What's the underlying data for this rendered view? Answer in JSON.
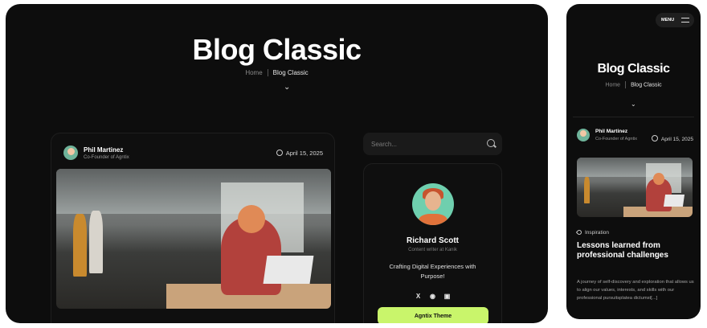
{
  "desktop": {
    "hero": {
      "title": "Blog Classic",
      "breadcrumb_home": "Home",
      "breadcrumb_current": "Blog Classic"
    },
    "post": {
      "author_name": "Phil Martinez",
      "author_role": "Co-Founder of Agntix",
      "date": "April 15, 2025"
    },
    "sidebar": {
      "search_placeholder": "Search...",
      "profile": {
        "name": "Richard Scott",
        "role": "Content writer at Kanik",
        "bio": "Crafting Digital Experiences with Purpose!",
        "socials": [
          "X",
          "dribbble-icon",
          "instagram-icon"
        ],
        "button_label": "Agntix Theme"
      }
    }
  },
  "mobile": {
    "menu_label": "MENU",
    "hero": {
      "title": "Blog Classic",
      "breadcrumb_home": "Home",
      "breadcrumb_current": "Blog Classic"
    },
    "post": {
      "author_name": "Phil Martinez",
      "author_role": "Co-Founder of Agntix",
      "date": "April 15, 2025",
      "tag": "Inspiration",
      "title": "Lessons learned from professional challenges",
      "excerpt": "A journey of self-discovery and exploration that allows us to align our values, interests, and skills with our professional pursuitsplatea dictumst[...]"
    }
  },
  "colors": {
    "background": "#0d0d0d",
    "accent": "#c9f56b"
  }
}
